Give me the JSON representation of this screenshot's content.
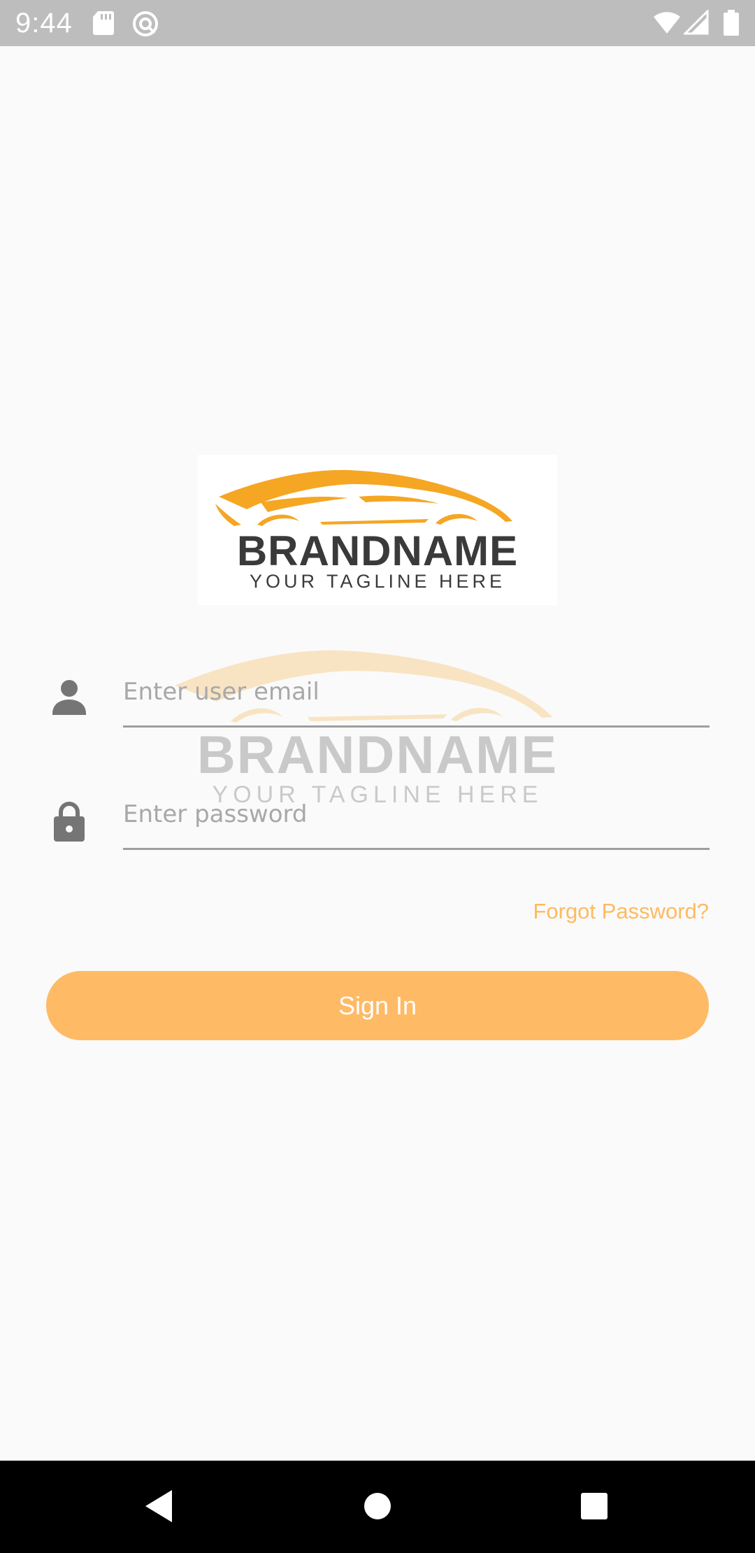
{
  "status_bar": {
    "time": "9:44",
    "icons": [
      "sd-card-icon",
      "sync-icon",
      "wifi-icon",
      "signal-icon",
      "battery-icon"
    ]
  },
  "logo": {
    "brand": "BRANDNAME",
    "tagline": "YOUR TAGLINE HERE",
    "accent_color": "#F5A623",
    "text_color": "#3a3a3a"
  },
  "login_form": {
    "email_placeholder": "Enter user email",
    "email_value": "",
    "password_placeholder": "Enter password",
    "password_value": "",
    "forgot_password_label": "Forgot Password?",
    "sign_in_label": "Sign In"
  },
  "colors": {
    "accent": "#FFBA66",
    "link": "#FFBA5E",
    "background": "#FAFAFA",
    "status_bar": "#BDBDBD",
    "nav_bar": "#000000"
  },
  "nav_bar": {
    "buttons": [
      "back-icon",
      "home-icon",
      "recents-icon"
    ]
  }
}
